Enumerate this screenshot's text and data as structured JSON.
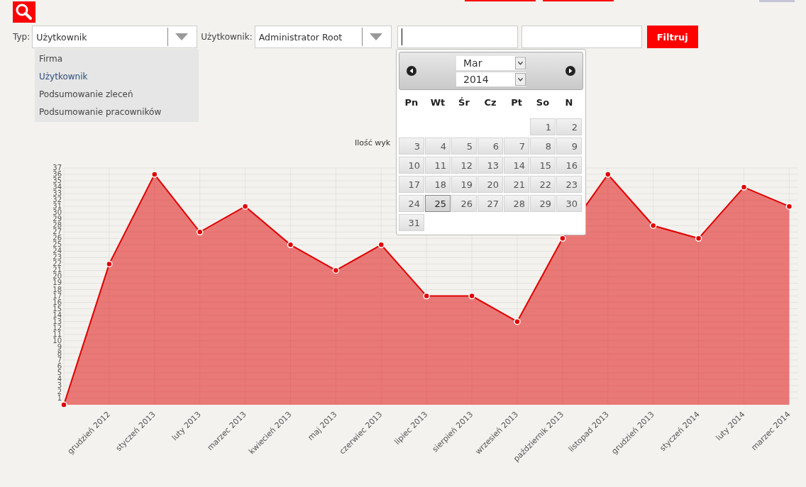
{
  "filters": {
    "type_label": "Typ:",
    "type_select": {
      "value": "Użytkownik"
    },
    "type_options": [
      {
        "label": "Firma",
        "selected": false
      },
      {
        "label": "Użytkownik",
        "selected": true
      },
      {
        "label": "Podsumowanie zleceń",
        "selected": false
      },
      {
        "label": "Podsumowanie pracowników",
        "selected": false
      }
    ],
    "user_label": "Użytkownik:",
    "user_select": {
      "value": "Administrator Root"
    },
    "button": "Filtruj"
  },
  "report": {
    "chart_title": "Ilość wyk"
  },
  "calendar": {
    "month": "Mar",
    "year": "2014",
    "weekdays": [
      "Pn",
      "Wt",
      "Śr",
      "Cz",
      "Pt",
      "So",
      "N"
    ],
    "weeks": [
      {
        "kind": "leading_partial",
        "days": [
          {
            "label": "1",
            "selected": false
          },
          {
            "label": "2",
            "selected": false
          }
        ]
      },
      {
        "kind": "full",
        "days": [
          {
            "label": "3",
            "selected": false
          },
          {
            "label": "4",
            "selected": false
          },
          {
            "label": "5",
            "selected": false
          },
          {
            "label": "6",
            "selected": false
          },
          {
            "label": "7",
            "selected": false
          },
          {
            "label": "8",
            "selected": false
          },
          {
            "label": "9",
            "selected": false
          }
        ]
      },
      {
        "kind": "full",
        "days": [
          {
            "label": "10",
            "selected": false
          },
          {
            "label": "11",
            "selected": false
          },
          {
            "label": "12",
            "selected": false
          },
          {
            "label": "13",
            "selected": false
          },
          {
            "label": "14",
            "selected": false
          },
          {
            "label": "15",
            "selected": false
          },
          {
            "label": "16",
            "selected": false
          }
        ]
      },
      {
        "kind": "full",
        "days": [
          {
            "label": "17",
            "selected": false
          },
          {
            "label": "18",
            "selected": false
          },
          {
            "label": "19",
            "selected": false
          },
          {
            "label": "20",
            "selected": false
          },
          {
            "label": "21",
            "selected": false
          },
          {
            "label": "22",
            "selected": false
          },
          {
            "label": "23",
            "selected": false
          }
        ]
      },
      {
        "kind": "full",
        "days": [
          {
            "label": "24",
            "selected": false
          },
          {
            "label": "25",
            "selected": true
          },
          {
            "label": "26",
            "selected": false
          },
          {
            "label": "27",
            "selected": false
          },
          {
            "label": "28",
            "selected": false
          },
          {
            "label": "29",
            "selected": false
          },
          {
            "label": "30",
            "selected": false
          }
        ]
      },
      {
        "kind": "trailing_partial",
        "days": [
          {
            "label": "31",
            "selected": false
          }
        ]
      }
    ]
  },
  "chart_data": {
    "type": "area",
    "grid": true,
    "categories": [
      null,
      "grudzień 2012",
      "styczeń 2013",
      "luty 2013",
      "marzec 2013",
      "kwiecień 2013",
      "maj 2013",
      "czerwiec 2013",
      "lipiec 2013",
      "sierpień 2013",
      "wrzesień 2013",
      "październik 2013",
      "listopad 2013",
      "grudzień 2013",
      "styczeń 2014",
      "luty 2014",
      "marzec 2014"
    ],
    "series": [
      {
        "color": "#e00000",
        "values": [
          0,
          22,
          36,
          27,
          31,
          25,
          21,
          25,
          17,
          17,
          13,
          26,
          36,
          28,
          26,
          34,
          31
        ]
      }
    ],
    "ylim": [
      0,
      37
    ],
    "yticks": [
      1,
      2,
      3,
      4,
      5,
      6,
      7,
      8,
      9,
      10,
      11,
      12,
      13,
      14,
      15,
      16,
      17,
      18,
      19,
      20,
      21,
      22,
      23,
      24,
      25,
      26,
      27,
      28,
      29,
      30,
      31,
      32,
      33,
      34,
      35,
      36,
      37
    ]
  }
}
